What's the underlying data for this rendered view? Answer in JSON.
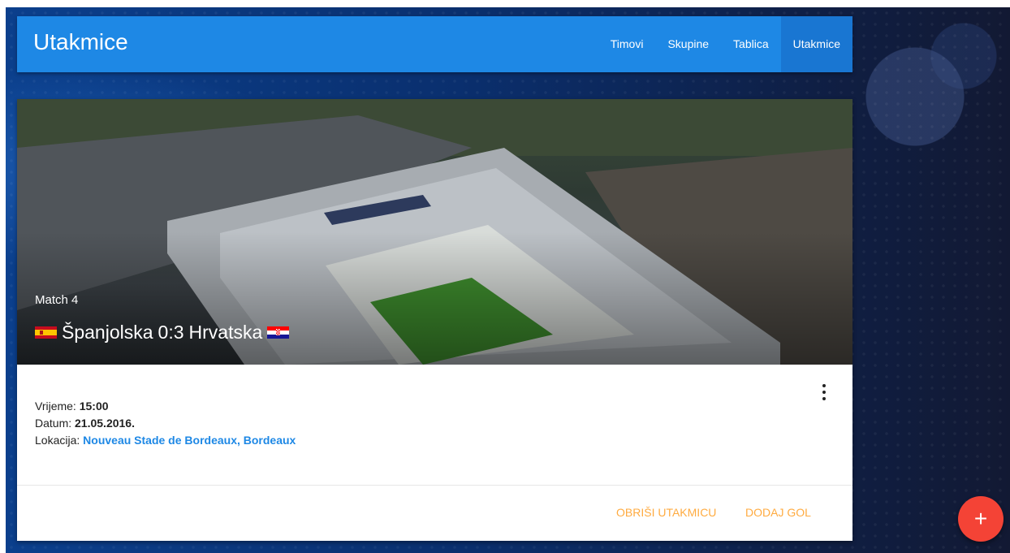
{
  "header": {
    "title": "Utakmice",
    "nav": [
      {
        "label": "Timovi",
        "active": false
      },
      {
        "label": "Skupine",
        "active": false
      },
      {
        "label": "Tablica",
        "active": false
      },
      {
        "label": "Utakmice",
        "active": true
      }
    ]
  },
  "match": {
    "label": "Match 4",
    "home_team": "Španjolska",
    "score": "0:3",
    "away_team": "Hrvatska",
    "home_flag": "spain-flag",
    "away_flag": "croatia-flag",
    "time_label": "Vrijeme:",
    "time": "15:00",
    "date_label": "Datum:",
    "date": "21.05.2016.",
    "location_label": "Lokacija:",
    "location": "Nouveau Stade de Bordeaux, Bordeaux"
  },
  "actions": {
    "delete": "OBRIŠI UTAKMICU",
    "add_goal": "DODAJ GOL",
    "fab": "+"
  },
  "icons": {
    "more": "more-vert-icon",
    "add": "add-icon"
  },
  "colors": {
    "primary": "#1e88e5",
    "primary_dark": "#1976d2",
    "accent": "#ffab40",
    "fab": "#f44336"
  }
}
